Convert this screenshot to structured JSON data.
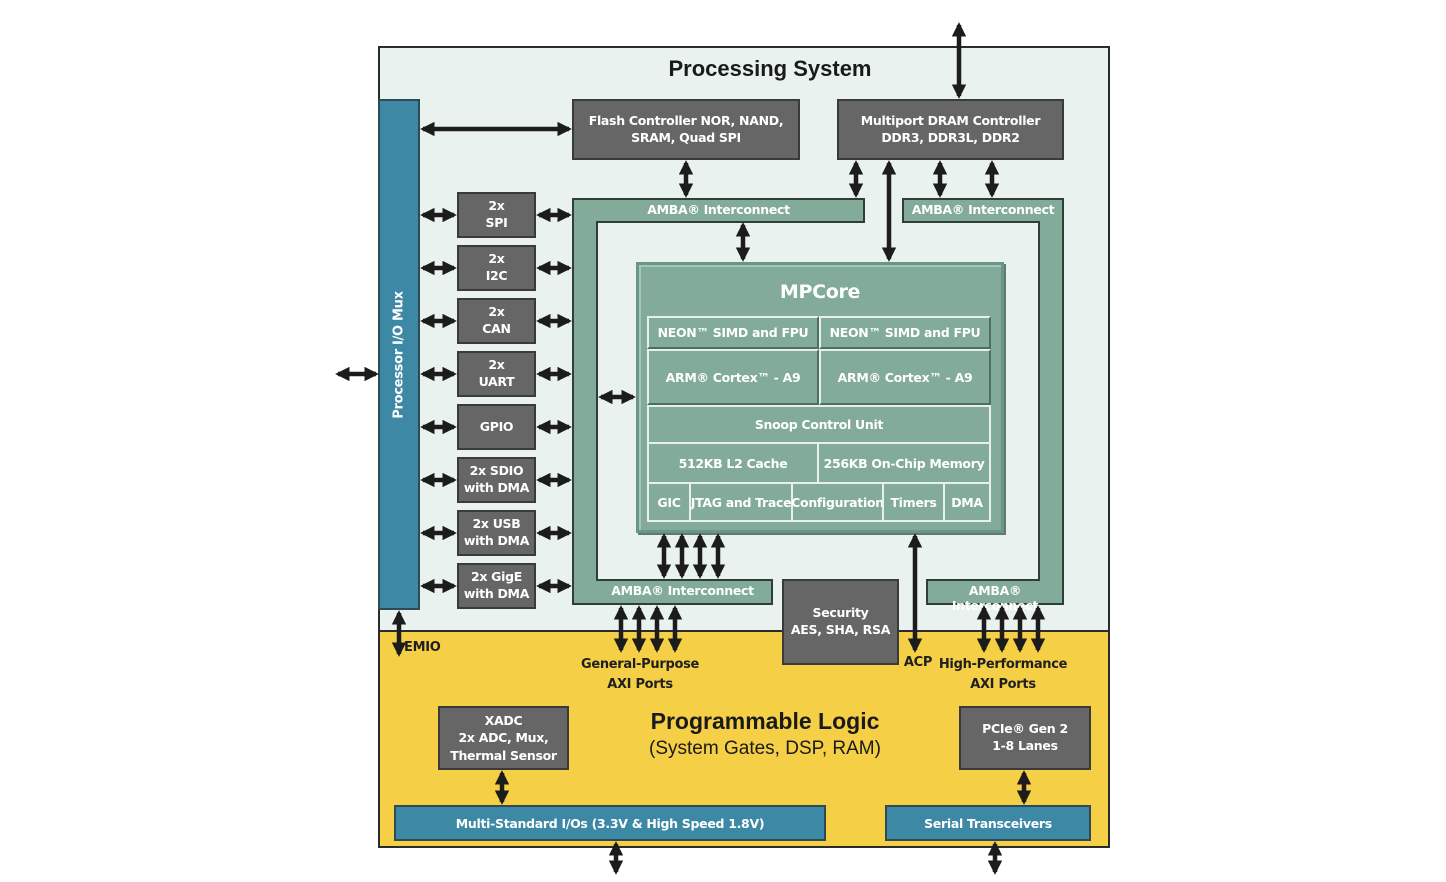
{
  "processing_system": {
    "title": "Processing System",
    "io_mux_label": "Processor I/O Mux",
    "flash_controller": "Flash Controller NOR, NAND,\nSRAM, Quad SPI",
    "dram_controller": "Multiport DRAM Controller\nDDR3, DDR3L, DDR2",
    "amba_label": "AMBA® Interconnect",
    "peripherals": [
      {
        "label": "2x\nSPI"
      },
      {
        "label": "2x\nI2C"
      },
      {
        "label": "2x\nCAN"
      },
      {
        "label": "2x\nUART"
      },
      {
        "label": "GPIO"
      },
      {
        "label": "2x SDIO\nwith DMA"
      },
      {
        "label": "2x USB\nwith DMA"
      },
      {
        "label": "2x GigE\nwith DMA"
      }
    ],
    "security": "Security\nAES, SHA, RSA",
    "mpcore": {
      "title": "MPCore",
      "neon": [
        "NEON™ SIMD and FPU",
        "NEON™ SIMD and FPU"
      ],
      "cores": [
        "ARM® Cortex™ - A9",
        "ARM® Cortex™ - A9"
      ],
      "scu": "Snoop Control Unit",
      "l2_cache": "512KB L2 Cache",
      "ocm": "256KB On-Chip Memory",
      "bottom_row": [
        "GIC",
        "JTAG and Trace",
        "Configuration",
        "Timers",
        "DMA"
      ]
    }
  },
  "ports": {
    "emio": "EMIO",
    "gp_axi": "General-Purpose\nAXI Ports",
    "acp": "ACP",
    "hp_axi": "High-Performance\nAXI Ports"
  },
  "programmable_logic": {
    "title": "Programmable Logic",
    "subtitle": "(System Gates, DSP, RAM)",
    "xadc": "XADC\n2x ADC, Mux,\nThermal Sensor",
    "pcie": "PCIe® Gen 2\n1-8 Lanes",
    "multi_io": "Multi-Standard I/Os (3.3V & High Speed 1.8V)",
    "serial_transceivers": "Serial Transceivers"
  }
}
